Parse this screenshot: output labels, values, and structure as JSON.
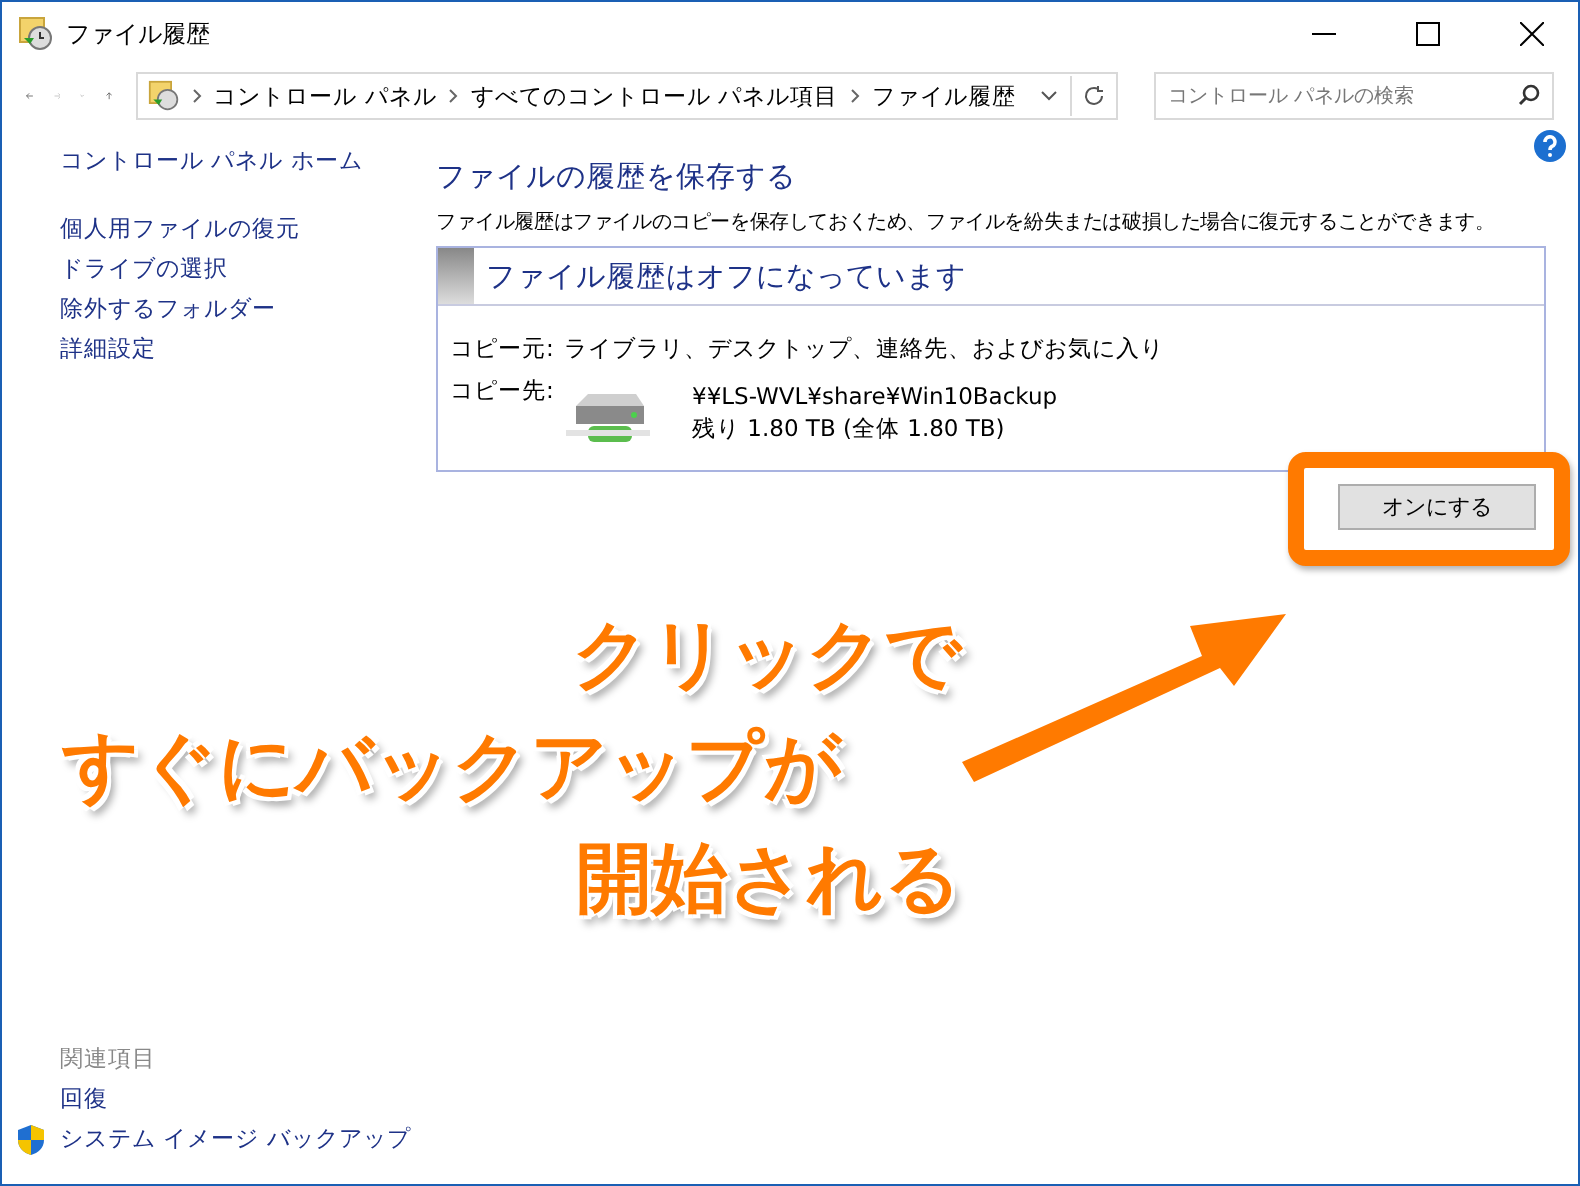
{
  "window": {
    "title": "ファイル履歴"
  },
  "address_bar": {
    "breadcrumbs": [
      "コントロール パネル",
      "すべてのコントロール パネル項目",
      "ファイル履歴"
    ]
  },
  "search": {
    "placeholder": "コントロール パネルの検索"
  },
  "sidebar": {
    "home": "コントロール パネル ホーム",
    "items": [
      "個人用ファイルの復元",
      "ドライブの選択",
      "除外するフォルダー",
      "詳細設定"
    ],
    "related_heading": "関連項目",
    "related": [
      {
        "label": "回復",
        "kind": "link"
      },
      {
        "label": "システム イメージ バックアップ",
        "kind": "shield"
      }
    ]
  },
  "main": {
    "heading": "ファイルの履歴を保存する",
    "description": "ファイル履歴はファイルのコピーを保存しておくため、ファイルを紛失または破損した場合に復元することができます。",
    "status_panel": {
      "title": "ファイル履歴はオフになっています",
      "source_label": "コピー元:",
      "source": "ライブラリ、デスクトップ、連絡先、およびお気に入り",
      "destination_label": "コピー先:",
      "destination_path": "¥¥LS-WVL¥share¥Win10Backup",
      "destination_space": "残り 1.80 TB (全体 1.80 TB)"
    },
    "button": "オンにする"
  },
  "annotation": {
    "lines": [
      "クリックで",
      "すぐにバックアップが",
      "開始される"
    ]
  }
}
